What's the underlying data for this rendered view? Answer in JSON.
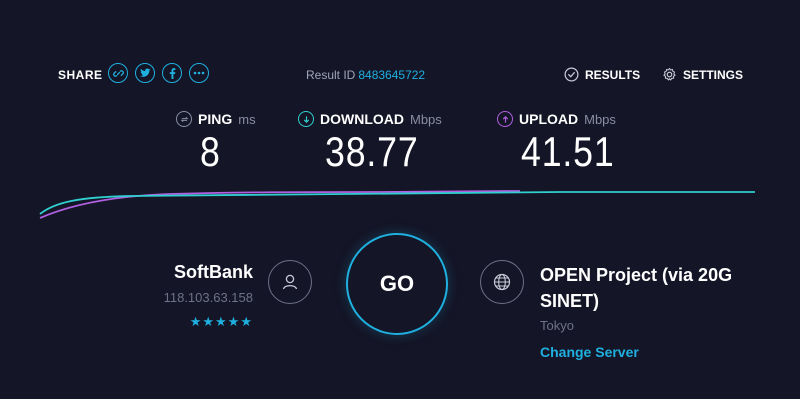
{
  "share": {
    "label": "SHARE",
    "icons": [
      "link-icon",
      "twitter-icon",
      "facebook-icon",
      "more-icon"
    ]
  },
  "result": {
    "label": "Result ID",
    "id": "8483645722"
  },
  "nav": {
    "results_label": "RESULTS",
    "settings_label": "SETTINGS"
  },
  "metrics": {
    "ping": {
      "label": "PING",
      "unit": "ms",
      "value": "8"
    },
    "download": {
      "label": "DOWNLOAD",
      "unit": "Mbps",
      "value": "38.77"
    },
    "upload": {
      "label": "UPLOAD",
      "unit": "Mbps",
      "value": "41.51"
    }
  },
  "isp": {
    "name": "SoftBank",
    "ip": "118.103.63.158",
    "stars": "★★★★★"
  },
  "go": {
    "label": "GO"
  },
  "server": {
    "name": "OPEN Project (via 20G SINET)",
    "location": "Tokyo",
    "change_label": "Change Server"
  },
  "colors": {
    "background": "#141526",
    "accent": "#1fb0e0",
    "upload": "#b060e0",
    "download": "#30d0d0"
  }
}
